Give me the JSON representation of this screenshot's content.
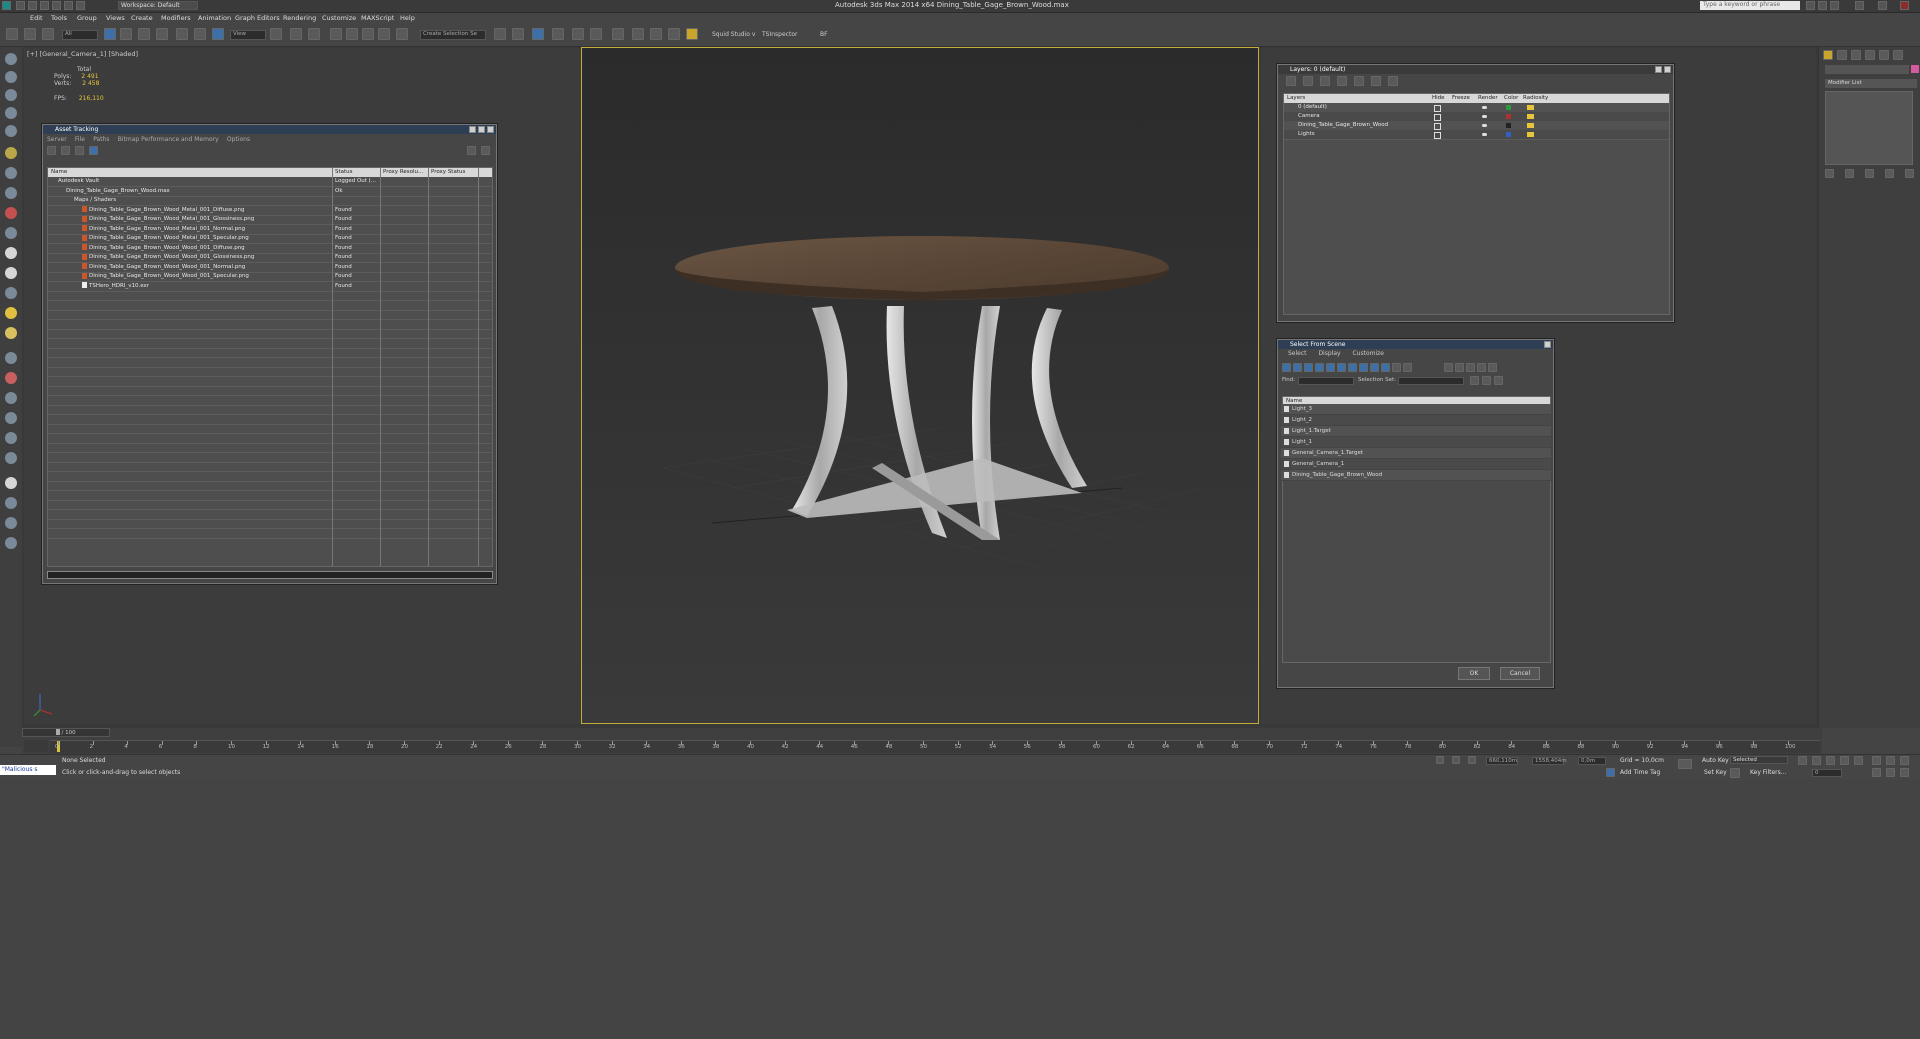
{
  "title_bar": {
    "app_title": "Autodesk 3ds Max  2014 x64     Dining_Table_Gage_Brown_Wood.max",
    "workspace": "Workspace: Default",
    "search_placeholder": "Type a keyword or phrase"
  },
  "menu": [
    "Edit",
    "Tools",
    "Group",
    "Views",
    "Create",
    "Modifiers",
    "Animation",
    "Graph Editors",
    "Rendering",
    "Customize",
    "MAXScript",
    "Help"
  ],
  "toolbar": {
    "filter_select": "All",
    "ref_coord": "View",
    "selection_set_placeholder": "Create Selection Se",
    "squid_label": "Squid Studio v",
    "inspector_label": "TSInspector",
    "bf_label": "BF"
  },
  "left_viewport": {
    "label": "[+] [General_Camera_1] [Shaded]",
    "stats": {
      "total": "Total",
      "polys_label": "Polys:",
      "polys": "2 491",
      "verts_label": "Verts:",
      "verts": "2 458",
      "fps_label": "FPS:",
      "fps": "216,110"
    }
  },
  "asset_tracking": {
    "title": "Asset Tracking",
    "menu": [
      "Server",
      "File",
      "Paths",
      "Bitmap Performance and Memory",
      "Options"
    ],
    "columns": [
      "Name",
      "Status",
      "Proxy Resolu...",
      "Proxy Status"
    ],
    "rows": [
      {
        "name": "Autodesk Vault",
        "status": "Logged Out (..."
      },
      {
        "name": "Dining_Table_Gage_Brown_Wood.max",
        "status": "Ok"
      },
      {
        "name": "Maps / Shaders",
        "status": ""
      },
      {
        "name": "Dining_Table_Gage_Brown_Wood_Metal_001_Diffuse.png",
        "status": "Found"
      },
      {
        "name": "Dining_Table_Gage_Brown_Wood_Metal_001_Glossiness.png",
        "status": "Found"
      },
      {
        "name": "Dining_Table_Gage_Brown_Wood_Metal_001_Normal.png",
        "status": "Found"
      },
      {
        "name": "Dining_Table_Gage_Brown_Wood_Metal_001_Specular.png",
        "status": "Found"
      },
      {
        "name": "Dining_Table_Gage_Brown_Wood_Wood_001_Diffuse.png",
        "status": "Found"
      },
      {
        "name": "Dining_Table_Gage_Brown_Wood_Wood_001_Glossiness.png",
        "status": "Found"
      },
      {
        "name": "Dining_Table_Gage_Brown_Wood_Wood_001_Normal.png",
        "status": "Found"
      },
      {
        "name": "Dining_Table_Gage_Brown_Wood_Wood_001_Specular.png",
        "status": "Found"
      },
      {
        "name": "TSHero_HDRI_v10.exr",
        "status": "Found"
      }
    ]
  },
  "layers": {
    "title": "Layers: 0 (default)",
    "columns": [
      "Layers",
      "Hide",
      "Freeze",
      "Render",
      "Color",
      "Radiosity"
    ],
    "rows": [
      "0 (default)",
      "Camera",
      "Dining_Table_Gage_Brown_Wood",
      "Lights"
    ],
    "row_colors": [
      "#2e9b3a",
      "#b03030",
      "#222222",
      "#3060c0"
    ]
  },
  "select_from_scene": {
    "title": "Select From Scene",
    "menu": [
      "Select",
      "Display",
      "Customize"
    ],
    "find_label": "Find:",
    "selection_set_label": "Selection Set:",
    "column_name": "Name",
    "rows": [
      "Light_3",
      "Light_2",
      "Light_1.Target",
      "Light_1",
      "General_Camera_1.Target",
      "General_Camera_1",
      "Dining_Table_Gage_Brown_Wood"
    ],
    "ok": "OK",
    "cancel": "Cancel"
  },
  "command_panel": {
    "modifier_list": "Modifier List"
  },
  "timeline": {
    "frame_counter": "0 / 100",
    "ticks": [
      "0",
      "2",
      "4",
      "6",
      "8",
      "10",
      "12",
      "14",
      "16",
      "18",
      "20",
      "22",
      "24",
      "26",
      "28",
      "30",
      "32",
      "34",
      "36",
      "38",
      "40",
      "42",
      "44",
      "46",
      "48",
      "50",
      "52",
      "54",
      "56",
      "58",
      "60",
      "62",
      "64",
      "66",
      "68",
      "70",
      "72",
      "74",
      "76",
      "78",
      "80",
      "82",
      "84",
      "86",
      "88",
      "90",
      "92",
      "94",
      "96",
      "98",
      "100"
    ]
  },
  "status": {
    "maxscript": "\"Malicious s",
    "none_selected": "None Selected",
    "prompt": "Click or click-and-drag to select objects",
    "x": "660,110m",
    "y": "1558,404m",
    "z": "0,0m",
    "grid": "Grid = 10,0cm",
    "add_time_tag": "Add Time Tag",
    "auto_key": "Auto Key",
    "set_key": "Set Key",
    "selected": "Selected",
    "key_filters": "Key Filters...",
    "frame": "0"
  }
}
